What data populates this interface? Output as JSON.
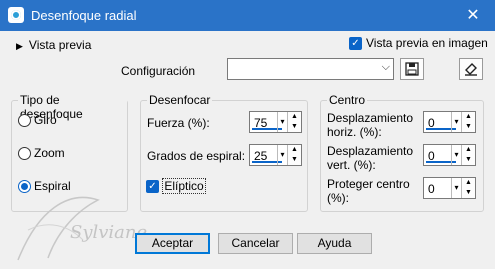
{
  "window": {
    "title": "Desenfoque radial",
    "close_icon": "close-icon"
  },
  "preview": {
    "toggle_label": "Vista previa",
    "checkbox_label": "Vista previa en imagen",
    "checkbox_checked": true
  },
  "config": {
    "label": "Configuración",
    "value": "",
    "save_icon": "floppy-disk-icon",
    "reset_icon": "eraser-icon"
  },
  "blur_type": {
    "legend": "Tipo de desenfoque",
    "options": [
      {
        "label": "Giro",
        "selected": false
      },
      {
        "label": "Zoom",
        "selected": false
      },
      {
        "label": "Espiral",
        "selected": true
      }
    ]
  },
  "blur": {
    "legend": "Desenfocar",
    "strength_label": "Fuerza (%):",
    "strength_value": "75",
    "spiral_label": "Grados de espiral:",
    "spiral_value": "25",
    "elliptic_label": "Elíptico",
    "elliptic_checked": true
  },
  "center": {
    "legend": "Centro",
    "horiz_label_1": "Desplazamiento",
    "horiz_label_2": "horiz. (%):",
    "horiz_value": "0",
    "vert_label_1": "Desplazamiento",
    "vert_label_2": "vert. (%):",
    "vert_value": "0",
    "protect_label_1": "Proteger centro",
    "protect_label_2": "(%):",
    "protect_value": "0"
  },
  "buttons": {
    "accept": "Aceptar",
    "cancel": "Cancelar",
    "help": "Ayuda"
  },
  "watermark": {
    "text": "Sylviane"
  },
  "colors": {
    "titlebar": "#2a73c8",
    "accent": "#0a64c8"
  }
}
